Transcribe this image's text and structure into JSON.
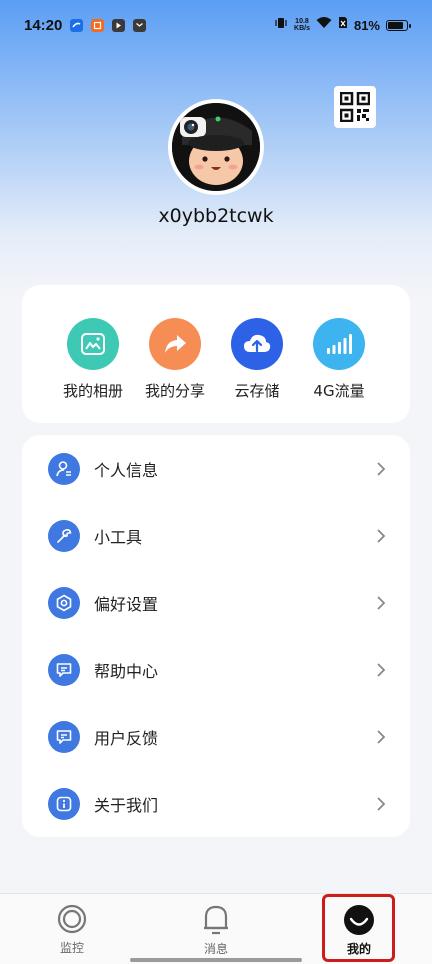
{
  "status_bar": {
    "time": "14:20",
    "net_speed_value": "10.8",
    "net_speed_unit": "KB/s",
    "battery_percent": "81%",
    "battery_level": 0.81,
    "icons": [
      "app-icon-1",
      "app-icon-2",
      "app-icon-3",
      "app-icon-4",
      "vibrate-icon",
      "sim-icon",
      "wifi-icon",
      "battery-icon"
    ],
    "app_icon_colors": [
      "#1b6fe8",
      "#f26b1d",
      "#3a3a3a",
      "#3a3a3a"
    ]
  },
  "profile": {
    "username": "x0ybb2tcwk",
    "qr_icon": "qr-code-icon"
  },
  "quick_actions": [
    {
      "label": "我的相册",
      "icon": "photo-album-icon",
      "color": "#3ec9b4"
    },
    {
      "label": "我的分享",
      "icon": "share-icon",
      "color": "#f58d55"
    },
    {
      "label": "云存储",
      "icon": "cloud-upload-icon",
      "color": "#2d62e6"
    },
    {
      "label": "4G流量",
      "icon": "signal-bars-icon",
      "color": "#3db4f0"
    }
  ],
  "menu": [
    {
      "label": "个人信息",
      "icon": "person-info-icon"
    },
    {
      "label": "小工具",
      "icon": "wrench-icon"
    },
    {
      "label": "偏好设置",
      "icon": "settings-hexagon-icon"
    },
    {
      "label": "帮助中心",
      "icon": "chat-help-icon"
    },
    {
      "label": "用户反馈",
      "icon": "feedback-icon"
    },
    {
      "label": "关于我们",
      "icon": "info-icon"
    }
  ],
  "bottom_nav": [
    {
      "label": "监控",
      "icon": "monitor-ring-icon",
      "active": false
    },
    {
      "label": "消息",
      "icon": "bell-icon",
      "active": false
    },
    {
      "label": "我的",
      "icon": "smile-face-icon",
      "active": true
    }
  ],
  "colors": {
    "accent": "#3f78e0",
    "highlight_frame": "#cc1c1c"
  }
}
